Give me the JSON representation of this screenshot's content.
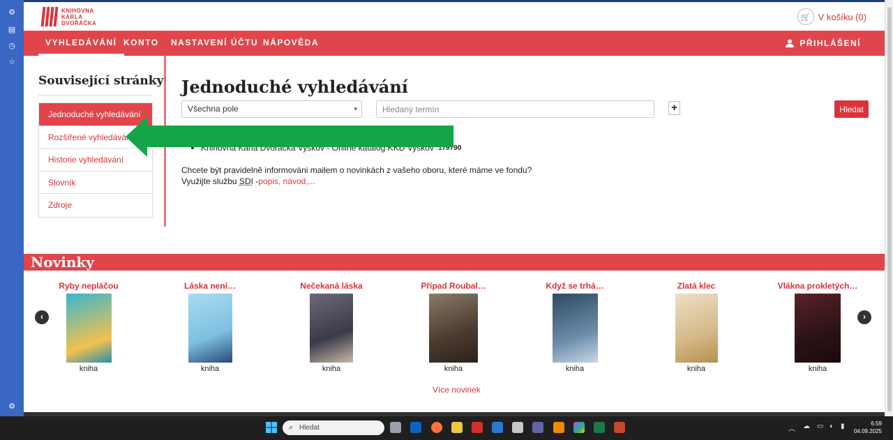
{
  "header": {
    "logo_lines": [
      "KNIHOVNA",
      "KARLA",
      "DVOŘÁČKA"
    ],
    "cart_label": "V košíku (0)"
  },
  "nav": {
    "items": [
      "VYHLEDÁVÁNÍ",
      "KONTO",
      "NASTAVENÍ ÚČTU",
      "NÁPOVĚDA"
    ],
    "login": "PŘIHLÁŠENÍ"
  },
  "sidebar": {
    "title": "Související stránky",
    "items": [
      "Jednoduché vyhledávání",
      "Rozšířené vyhledávání",
      "Historie vyhledávání",
      "Slovník",
      "Zdroje"
    ]
  },
  "main": {
    "title": "Jednoduché vyhledávání",
    "select_value": "Všechna pole",
    "search_placeholder": "Hledaný termín",
    "plus_label": "+",
    "search_button": "Hledat",
    "catalog_text": "Knihovna Karla Dvořáčka Vyškov - Online katalog KKD Vyškov",
    "catalog_count": "179790",
    "info_line1": "Chcete být pravidelně informováni mailem o novinkách z vašeho oboru, které máme ve fondu?",
    "info_line2_prefix": "Využijte službu ",
    "info_sdi": "SDI",
    "info_line2_dash": " -",
    "info_link": "popis, návod,..."
  },
  "novinky": {
    "title": "Novinky",
    "more_link": "Více novinek",
    "books": [
      {
        "title": "Ryby nepláčou",
        "type": "kniha",
        "color": "#3aa9c8"
      },
      {
        "title": "Láska není…",
        "type": "kniha",
        "color": "#8fc9e8"
      },
      {
        "title": "Nečekaná láska",
        "type": "kniha",
        "color": "#4a4a58"
      },
      {
        "title": "Případ Roubal…",
        "type": "kniha",
        "color": "#6b5a4a"
      },
      {
        "title": "Když se trhá…",
        "type": "kniha",
        "color": "#3f5f78"
      },
      {
        "title": "Zlatá klec",
        "type": "kniha",
        "color": "#d8c9a8"
      },
      {
        "title": "Vlákna prokletých…",
        "type": "kniha",
        "color": "#3a1a1e"
      }
    ]
  },
  "taskbar": {
    "search_placeholder": "Hledat",
    "time": "6:59",
    "date": "04.09.2025"
  }
}
